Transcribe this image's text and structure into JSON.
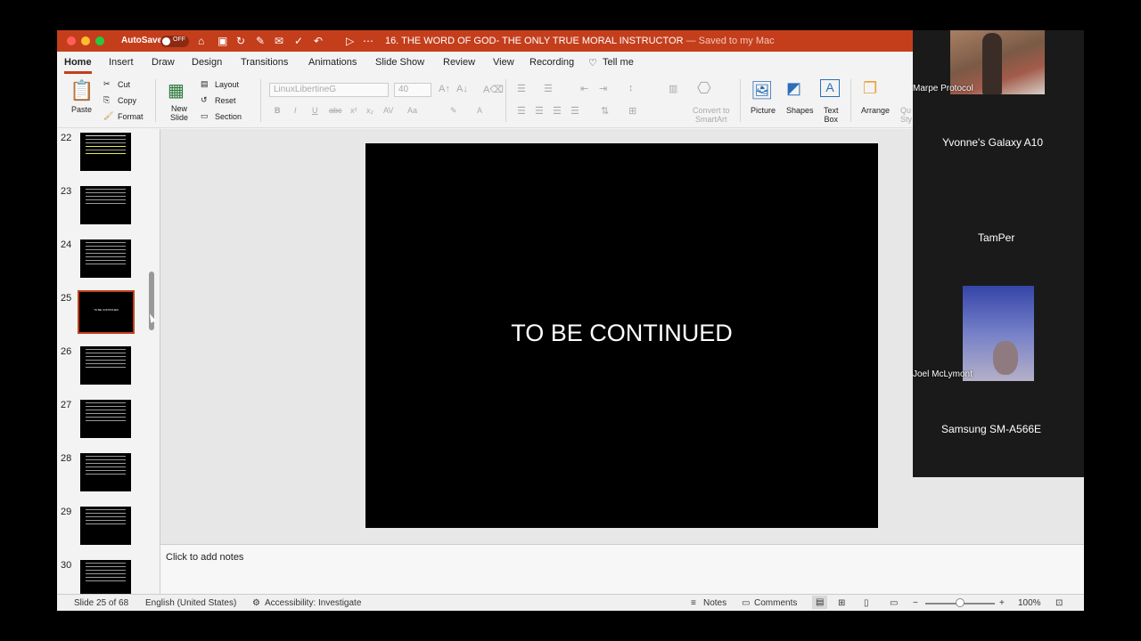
{
  "titlebar": {
    "autosave_label": "AutoSave",
    "autosave_state": "OFF",
    "doc_title": "16. THE WORD OF GOD- THE ONLY TRUE MORAL INSTRUCTOR",
    "saved_status": "— Saved to my Mac"
  },
  "tabs": [
    "Home",
    "Insert",
    "Draw",
    "Design",
    "Transitions",
    "Animations",
    "Slide Show",
    "Review",
    "View",
    "Recording",
    "Tell me"
  ],
  "ribbon": {
    "paste": "Paste",
    "cut": "Cut",
    "copy": "Copy",
    "format": "Format",
    "new_slide": "New\nSlide",
    "layout": "Layout",
    "reset": "Reset",
    "section": "Section",
    "font_name": "LinuxLibertineG",
    "font_size": "40",
    "convert_smartart": "Convert to\nSmartArt",
    "picture": "Picture",
    "shapes": "Shapes",
    "text_box": "Text\nBox",
    "arrange": "Arrange",
    "quick_styles": "Qu\nSty"
  },
  "thumbnails": [
    {
      "num": "22"
    },
    {
      "num": "23"
    },
    {
      "num": "24"
    },
    {
      "num": "25",
      "text": "TO BE CONTINUED"
    },
    {
      "num": "26"
    },
    {
      "num": "27"
    },
    {
      "num": "28"
    },
    {
      "num": "29"
    },
    {
      "num": "30"
    }
  ],
  "slide": {
    "text": "TO BE CONTINUED"
  },
  "notes": {
    "placeholder": "Click to add notes"
  },
  "status": {
    "slide_counter": "Slide 25 of 68",
    "language": "English (United States)",
    "accessibility": "Accessibility: Investigate",
    "notes": "Notes",
    "comments": "Comments",
    "zoom": "100%"
  },
  "zoom_participants": [
    {
      "name": "Marpe Protocol"
    },
    {
      "name": "Yvonne's Galaxy A10"
    },
    {
      "name": "TamPer"
    },
    {
      "name": "Joel McLymont"
    },
    {
      "name": "Samsung SM-A566E"
    }
  ],
  "colors": {
    "accent": "#c43e1c",
    "slide_bg": "#000000"
  }
}
